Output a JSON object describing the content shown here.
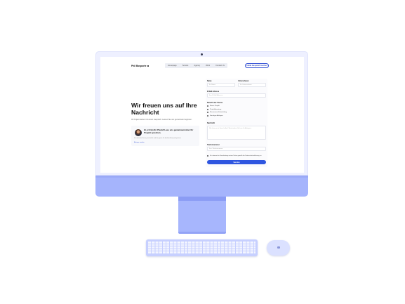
{
  "nav": {
    "brand": "Phil Bosporte",
    "links": [
      "Homepage",
      "Service",
      "Agency",
      "Work",
      "Contact Us"
    ],
    "cta": "Initial Gespräch buchen"
  },
  "hero": {
    "title": "Wir freuen uns auf Ihre Nachricht",
    "subtitle": "Ihr Projekt starten mit einem Gespräch. Lassen Sie uns gemeinsam beginnen."
  },
  "card": {
    "title": "Hi, ich bin Ihr Pixeld! Lass uns gemeinsam über Ihr Projekt sprechen.",
    "text": "Ich antworte Ihnen persönlich und bin gerne Ihr direkter Ansprechpartner.",
    "link": "Anfrage senden"
  },
  "form": {
    "name_label": "Name",
    "name_placeholder": "Ihr Name",
    "company_label": "Unternehmen",
    "company_placeholder": "Ihr Unternehmen",
    "email_label": "E-Mail Adresse",
    "email_placeholder": "Ihre E-Mail Adresse",
    "topic_label": "Betreff oder Thema",
    "topics": [
      "Neues Projekt",
      "Produktberatung",
      "Ressourcen Entwicklung",
      "Sonstiges Anliegen"
    ],
    "message_label": "Nachricht",
    "message_placeholder": "Wie können wir Ihnen helfen? Beschreiben Sie kurz Ihr Anliegen...",
    "phone_label": "Telefonnummer",
    "phone_placeholder": "Ihre Telefonnummer",
    "consent": "Ich stimme der Verarbeitung meiner Daten gemäß der Datenschutzerklärung zu.",
    "submit": "Senden"
  },
  "colors": {
    "accent": "#2f56e0",
    "device": "#a5b4fc",
    "bezel": "#eef0ff"
  }
}
